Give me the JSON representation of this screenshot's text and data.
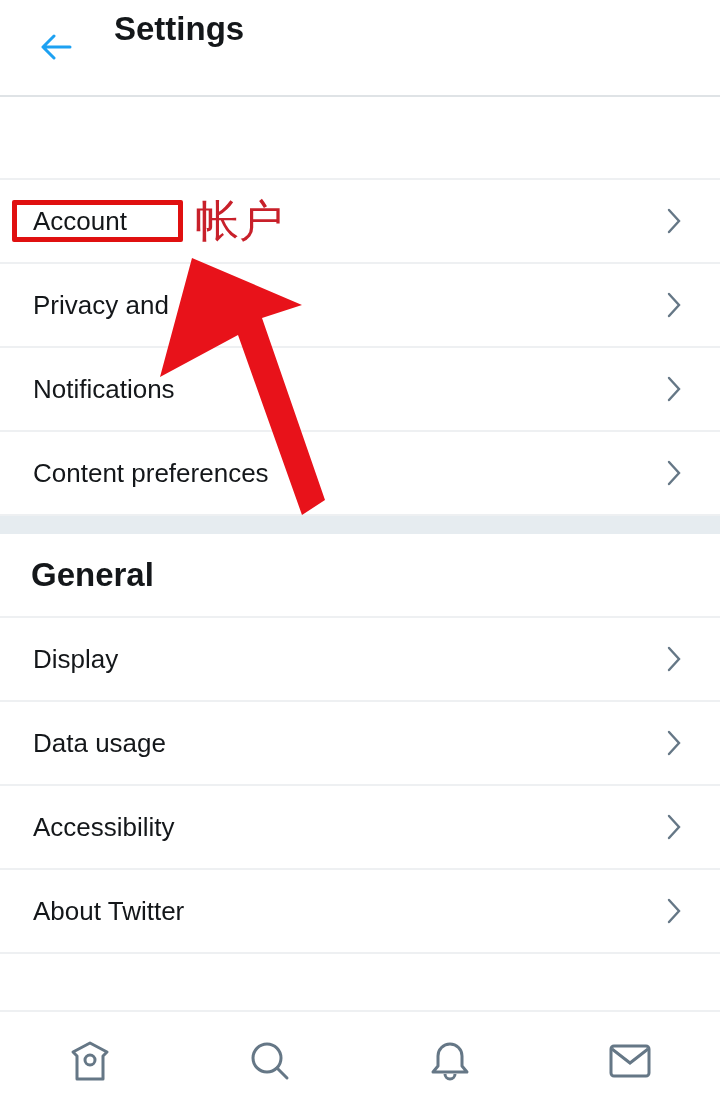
{
  "header": {
    "title": "Settings"
  },
  "sections": [
    {
      "items": [
        {
          "label": "Account",
          "highlighted": true
        },
        {
          "label": "Privacy and",
          "highlighted": false
        },
        {
          "label": "Notifications",
          "highlighted": false
        },
        {
          "label": "Content preferences",
          "highlighted": false
        }
      ]
    },
    {
      "heading": "General",
      "items": [
        {
          "label": "Display",
          "highlighted": false
        },
        {
          "label": "Data usage",
          "highlighted": false
        },
        {
          "label": "Accessibility",
          "highlighted": false
        },
        {
          "label": "About Twitter",
          "highlighted": false
        }
      ]
    }
  ],
  "annotation": {
    "label": "帐户"
  },
  "bottom_nav": [
    {
      "kind": "home"
    },
    {
      "kind": "search"
    },
    {
      "kind": "notifications"
    },
    {
      "kind": "messages"
    }
  ]
}
